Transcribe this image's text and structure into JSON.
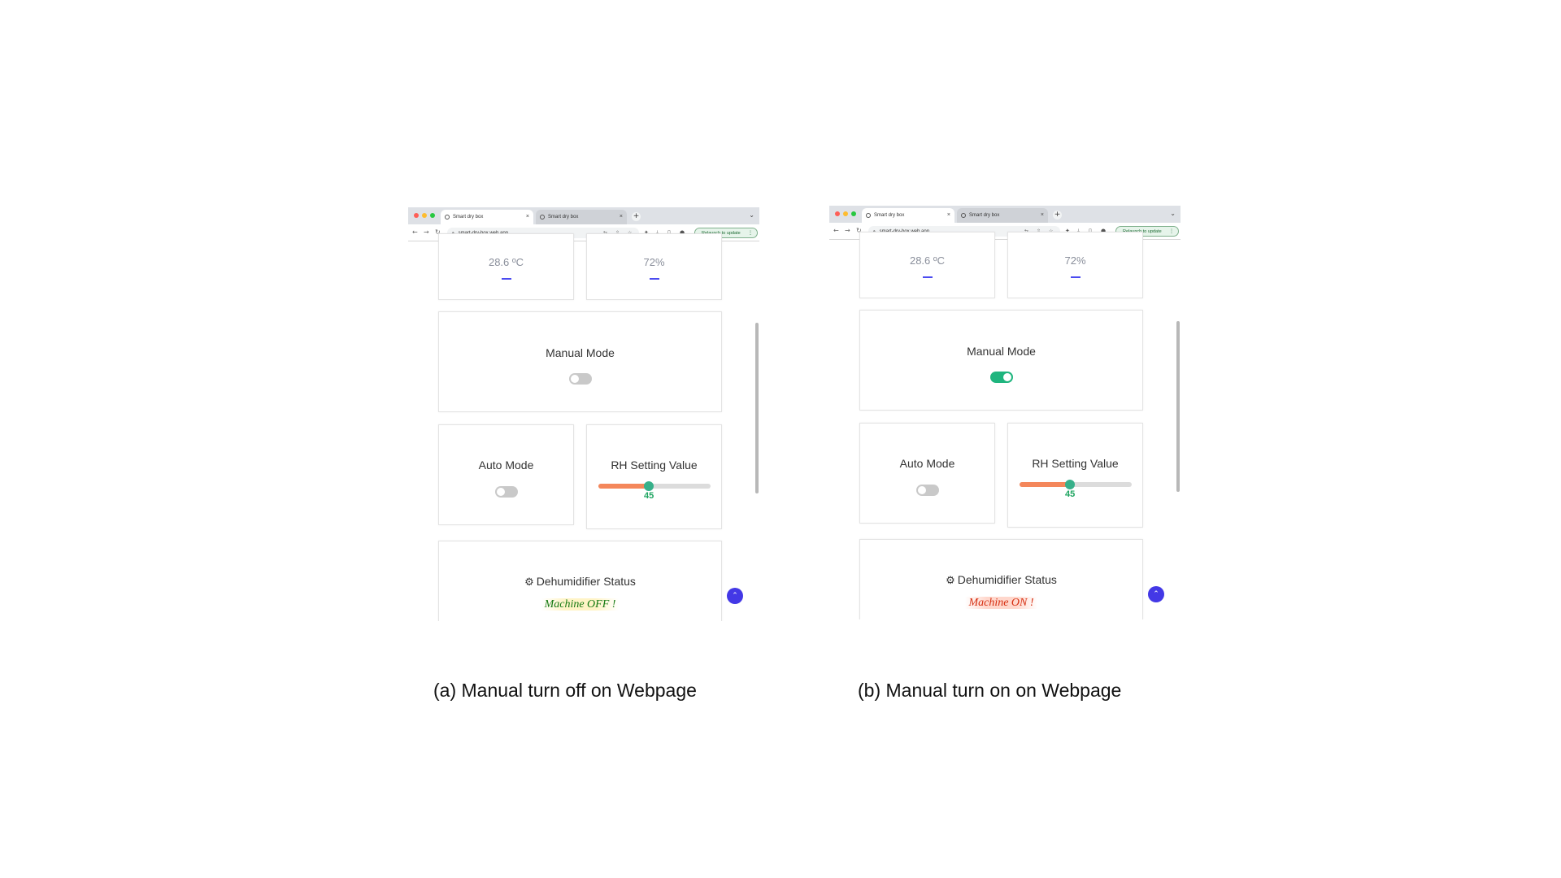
{
  "panels": [
    {
      "browser": {
        "tabs": [
          "Smart dry box",
          "Smart dry box"
        ],
        "url": "smart-dry-box.web.app",
        "relaunch_label": "Relaunch to update"
      },
      "temperature": "28.6 ºC",
      "humidity": "72%",
      "manual_mode": {
        "label": "Manual Mode",
        "state": "off"
      },
      "auto_mode": {
        "label": "Auto Mode",
        "state": "off"
      },
      "rh_setting": {
        "label": "RH Setting Value",
        "value": 45,
        "fill_fraction": 0.45
      },
      "dehumidifier": {
        "label": "Dehumidifier Status",
        "status_text": "Machine OFF !"
      }
    },
    {
      "browser": {
        "tabs": [
          "Smart dry box",
          "Smart dry box"
        ],
        "url": "smart-dry-box.web.app",
        "relaunch_label": "Relaunch to update"
      },
      "temperature": "28.6 ºC",
      "humidity": "72%",
      "manual_mode": {
        "label": "Manual Mode",
        "state": "on"
      },
      "auto_mode": {
        "label": "Auto Mode",
        "state": "off"
      },
      "rh_setting": {
        "label": "RH Setting Value",
        "value": 45,
        "fill_fraction": 0.45
      },
      "dehumidifier": {
        "label": "Dehumidifier Status",
        "status_text": "Machine ON !"
      }
    }
  ],
  "captions": [
    "(a) Manual turn off on Webpage",
    "(b) Manual turn on on Webpage"
  ],
  "colors": {
    "toggle_on": "#1fb57e",
    "toggle_off": "#c9c9c9",
    "slider_fill": "#f4875b",
    "slider_thumb": "#37b08a",
    "status_off": "#167a12",
    "status_on": "#d62d0f",
    "accent": "#4338e6"
  }
}
